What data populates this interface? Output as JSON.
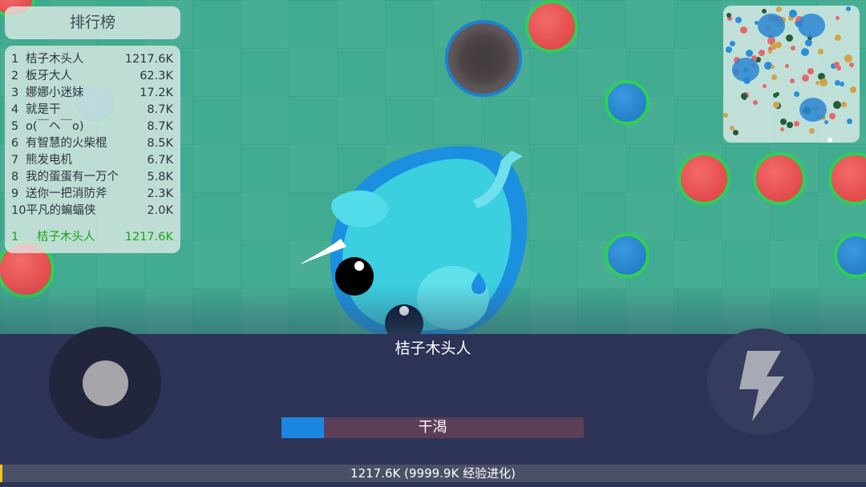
{
  "leaderboard": {
    "title": "排行榜",
    "entries": [
      {
        "rank": "1",
        "name": "桔子木头人",
        "score": "1217.6K"
      },
      {
        "rank": "2",
        "name": "板牙大人",
        "score": "62.3K"
      },
      {
        "rank": "3",
        "name": "娜娜小迷妹",
        "score": "17.2K"
      },
      {
        "rank": "4",
        "name": "就是干",
        "score": "8.7K"
      },
      {
        "rank": "5",
        "name": "o(￣ヘ￣o)",
        "score": "8.7K"
      },
      {
        "rank": "6",
        "name": "有智慧的火柴棍",
        "score": "8.5K"
      },
      {
        "rank": "7",
        "name": "熊发电机",
        "score": "6.7K"
      },
      {
        "rank": "8",
        "name": "我的蛋蛋有一万个",
        "score": "5.8K"
      },
      {
        "rank": "9",
        "name": "送你一把消防斧",
        "score": "2.3K"
      },
      {
        "rank": "10",
        "name": "平凡的蝙蝠侠",
        "score": "2.0K"
      }
    ],
    "self": {
      "rank": "1",
      "name": "桔子木头人",
      "score": "1217.6K"
    }
  },
  "player": {
    "name": "桔子木头人"
  },
  "thirst": {
    "label": "干渴",
    "fraction": 0.14
  },
  "xp": {
    "label": "1217.6K (9999.9K 经验进化)",
    "fraction": 0.003
  },
  "controls": {
    "joystick_icon": "joystick-icon",
    "boost_icon": "lightning-bolt-icon"
  },
  "colors": {
    "field": "#40ab90",
    "hud": "#2d3356",
    "thirst_fill": "#1c86e0",
    "thirst_track": "#5b3e58",
    "xp_fill": "#f0c419",
    "self_highlight": "#1aa51a"
  }
}
